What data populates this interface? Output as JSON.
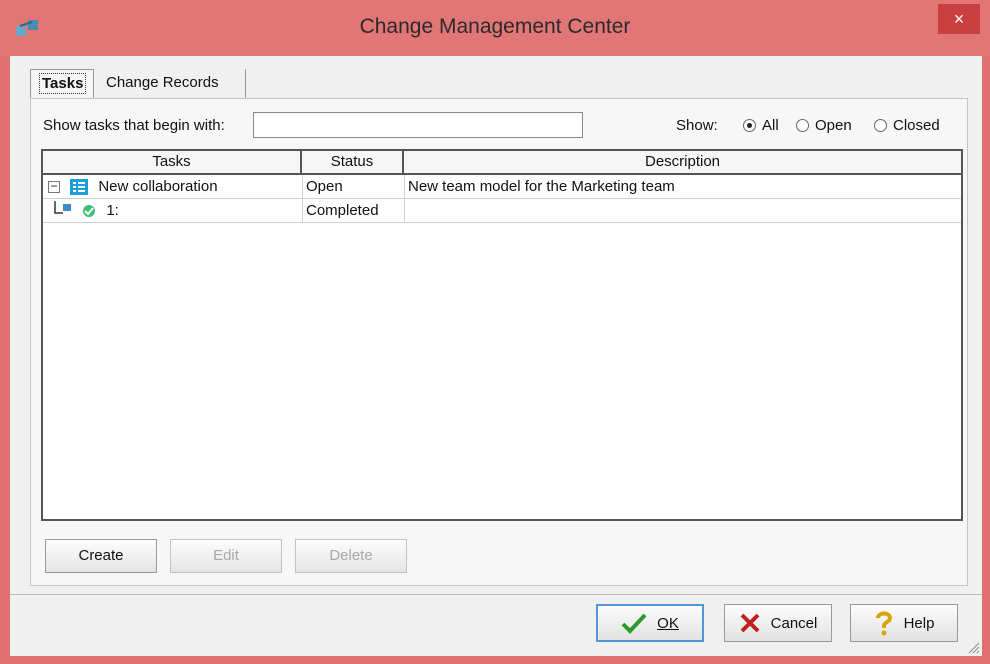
{
  "window": {
    "title": "Change Management Center",
    "close_glyph": "×"
  },
  "tabs": [
    {
      "label": "Tasks",
      "active": true
    },
    {
      "label": "Change Records",
      "active": false
    }
  ],
  "filter": {
    "label": "Show tasks that begin with:",
    "value": "",
    "placeholder": ""
  },
  "show": {
    "label": "Show:",
    "options": [
      {
        "label": "All",
        "selected": true
      },
      {
        "label": "Open",
        "selected": false
      },
      {
        "label": "Closed",
        "selected": false
      }
    ]
  },
  "table": {
    "columns": [
      "Tasks",
      "Status",
      "Description"
    ],
    "rows": [
      {
        "task": "New collaboration",
        "status": "Open",
        "description": "New team model for the Marketing team",
        "expander": "−",
        "icon": "task-list-icon"
      },
      {
        "task": "1:",
        "status": "Completed",
        "description": "",
        "icon": "change-record-icon"
      }
    ]
  },
  "actions": {
    "create": {
      "label": "Create",
      "enabled": true
    },
    "edit": {
      "label": "Edit",
      "enabled": false
    },
    "delete": {
      "label": "Delete",
      "enabled": false
    }
  },
  "dialog_buttons": {
    "ok": {
      "label": "OK",
      "icon": "checkmark-icon"
    },
    "cancel": {
      "label": "Cancel",
      "icon": "x-icon"
    },
    "help": {
      "label": "Help",
      "icon": "question-icon"
    }
  },
  "colors": {
    "titlebar": "#e27676",
    "close": "#c9403f",
    "accent": "#4f97d6"
  }
}
